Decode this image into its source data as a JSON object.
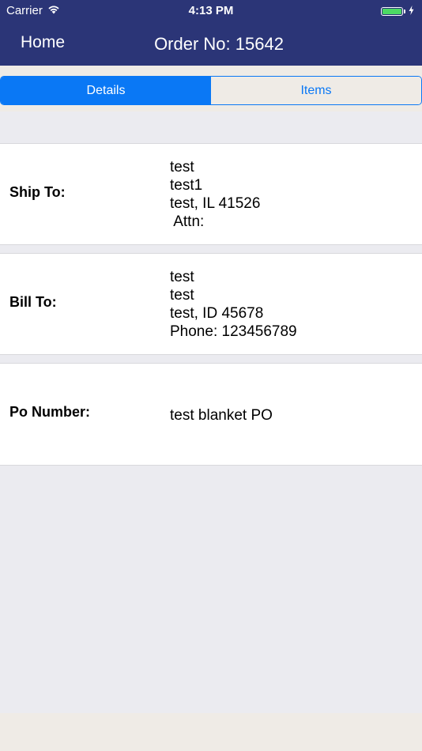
{
  "status_bar": {
    "carrier": "Carrier",
    "time": "4:13 PM",
    "wifi_icon": "wifi-icon",
    "battery_icon": "battery-icon",
    "battery_color": "#4cd964"
  },
  "nav": {
    "back_label": "Home",
    "title": "Order No: 15642",
    "bar_color": "#2b3577"
  },
  "tabs": [
    {
      "label": "Details",
      "selected": true
    },
    {
      "label": "Items",
      "selected": false
    }
  ],
  "accent_color": "#0a78f5",
  "sections": {
    "ship_to": {
      "label": "Ship To:",
      "lines": [
        "test",
        "test1",
        "test, IL 41526",
        " Attn:"
      ]
    },
    "bill_to": {
      "label": "Bill To:",
      "lines": [
        "test",
        "test",
        "test, ID 45678",
        "Phone: 123456789"
      ]
    },
    "po_number": {
      "label": "Po Number:",
      "lines": [
        "test blanket PO"
      ]
    }
  }
}
